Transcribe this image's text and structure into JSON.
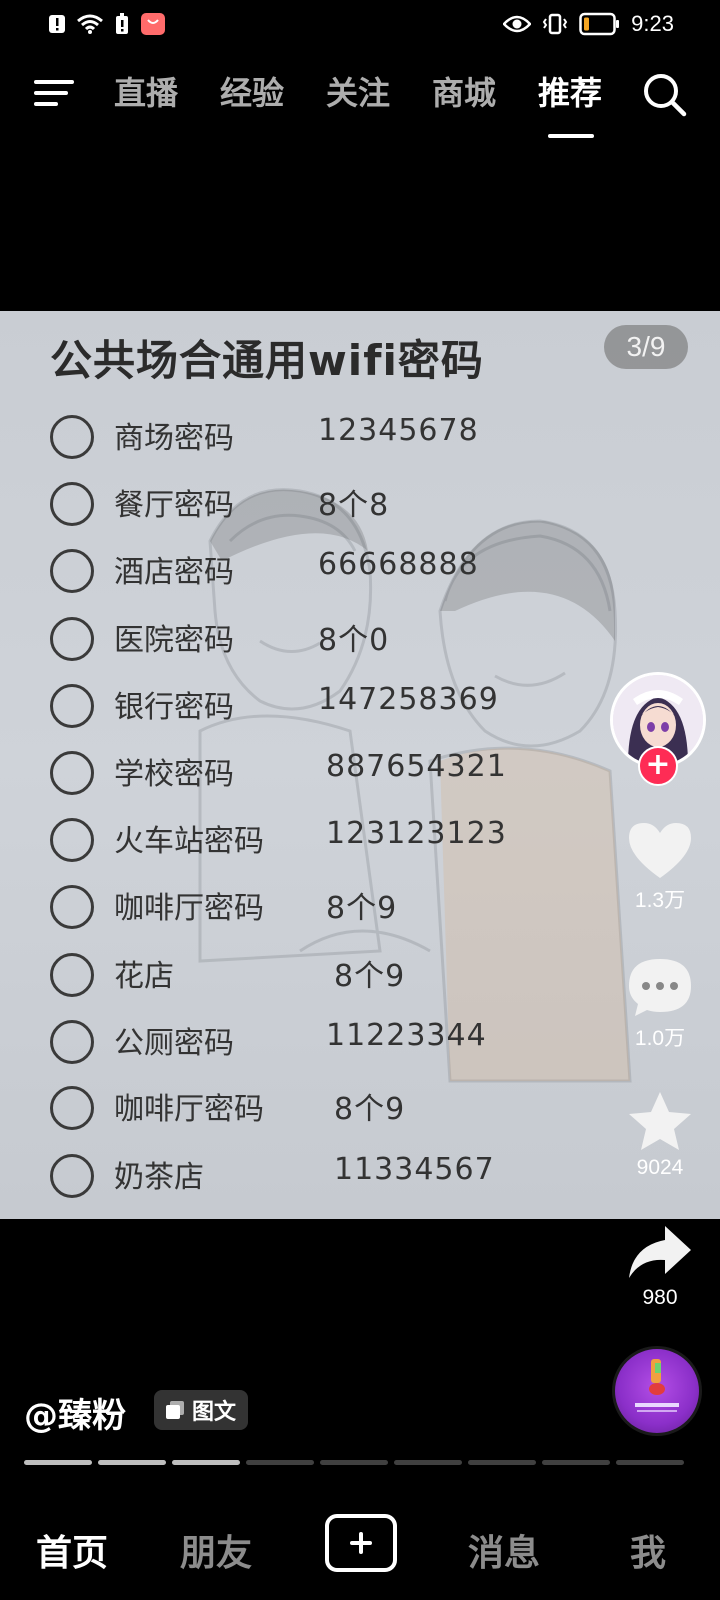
{
  "status_bar": {
    "time": "9:23",
    "icons": [
      "alert-icon",
      "wifi-icon",
      "alert-icon",
      "app-notification-icon",
      "eye-icon",
      "vibrate-icon",
      "battery-icon"
    ],
    "battery_color": "#f5a623"
  },
  "top_nav": {
    "tabs": [
      {
        "label": "直播",
        "active": false
      },
      {
        "label": "经验",
        "active": false
      },
      {
        "label": "关注",
        "active": false
      },
      {
        "label": "商城",
        "active": false
      },
      {
        "label": "推荐",
        "active": true
      }
    ]
  },
  "post": {
    "title": "公共场合通用wifi密码",
    "page_counter": "3/9",
    "rows": [
      {
        "place": "商场密码",
        "password": "12345678"
      },
      {
        "place": "餐厅密码",
        "password": "8个8"
      },
      {
        "place": "酒店密码",
        "password": "66668888"
      },
      {
        "place": "医院密码",
        "password": "8个0"
      },
      {
        "place": "银行密码",
        "password": "147258369"
      },
      {
        "place": "学校密码",
        "password": "887654321"
      },
      {
        "place": "火车站密码",
        "password": "123123123"
      },
      {
        "place": "咖啡厅密码",
        "password": "8个9"
      },
      {
        "place": "花店",
        "password": "8个9"
      },
      {
        "place": "公厕密码",
        "password": "11223344"
      },
      {
        "place": "咖啡厅密码",
        "password": "8个9"
      },
      {
        "place": "奶茶店",
        "password": "11334567"
      }
    ]
  },
  "actions": {
    "likes": "1.3万",
    "comments": "1.0万",
    "favorites": "9024",
    "shares": "980",
    "follow_label": "+"
  },
  "author": {
    "handle": "@臻粉",
    "tag": "图文"
  },
  "progress": {
    "total": 9,
    "current": 3
  },
  "bottom_nav": {
    "home": "首页",
    "friends": "朋友",
    "messages": "消息",
    "me": "我"
  },
  "colors": {
    "accent": "#fe2c55",
    "background": "#000000"
  }
}
